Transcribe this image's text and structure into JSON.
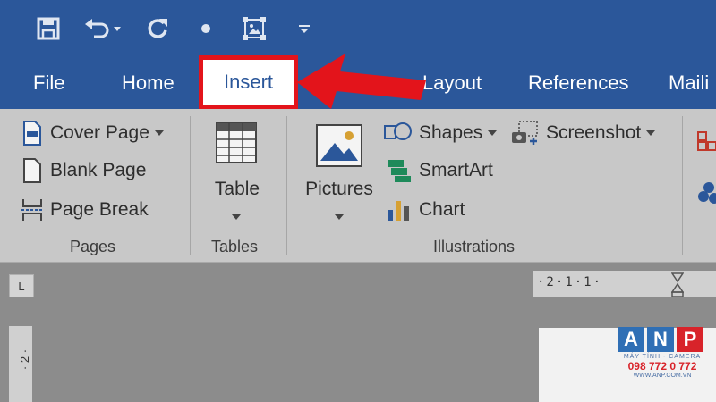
{
  "quick_access": {
    "icons": [
      "save-icon",
      "undo-icon",
      "redo-icon",
      "dot-icon",
      "select-icon",
      "customize-icon"
    ]
  },
  "tabs": {
    "file": "File",
    "home": "Home",
    "insert": "Insert",
    "layout": "Layout",
    "references": "References",
    "mailings_partial": "Maili"
  },
  "ribbon": {
    "pages": {
      "cover_page": "Cover Page",
      "blank_page": "Blank Page",
      "page_break": "Page Break",
      "group_label": "Pages"
    },
    "tables": {
      "table": "Table",
      "group_label": "Tables"
    },
    "illustrations": {
      "pictures": "Pictures",
      "shapes": "Shapes",
      "smartart": "SmartArt",
      "chart": "Chart",
      "screenshot": "Screenshot",
      "group_label": "Illustrations"
    }
  },
  "document": {
    "ruler_corner": "L",
    "hruler_text": "·2·1·1·",
    "vruler_text": "· 2 ·"
  },
  "watermark": {
    "letters": [
      "A",
      "N",
      "P"
    ],
    "tagline": "MÁY TÍNH - CAMERA",
    "phone": "098 772 0 772",
    "website": "WWW.ANP.COM.VN"
  },
  "colors": {
    "ribbon_blue": "#2b579a",
    "highlight_red": "#e3141b"
  }
}
